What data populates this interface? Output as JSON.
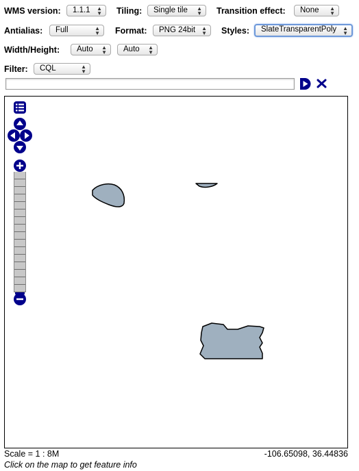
{
  "controls": {
    "wms_version": {
      "label": "WMS version:",
      "value": "1.1.1"
    },
    "tiling": {
      "label": "Tiling:",
      "value": "Single tile"
    },
    "transition": {
      "label": "Transition effect:",
      "value": "None"
    },
    "antialias": {
      "label": "Antialias:",
      "value": "Full"
    },
    "format": {
      "label": "Format:",
      "value": "PNG 24bit"
    },
    "styles": {
      "label": "Styles:",
      "value": "SlateTransparentPoly"
    },
    "size": {
      "label": "Width/Height:",
      "width": "Auto",
      "height": "Auto"
    },
    "filter": {
      "label": "Filter:",
      "value": "CQL",
      "text": ""
    }
  },
  "icons": {
    "apply": "play-icon",
    "reset": "close-icon",
    "layer_switcher": "layers-icon",
    "pan": "pan-arrows-icon",
    "zoom_in": "plus-icon",
    "zoom_out": "minus-icon"
  },
  "map": {
    "feature_fill": "#9fb0bf",
    "feature_stroke": "#000000",
    "control_color": "#00008b",
    "zoom_levels": 16
  },
  "status": {
    "scale": "Scale = 1 : 8M",
    "coords": "-106.65098, 36.44836",
    "hint": "Click on the map to get feature info"
  }
}
